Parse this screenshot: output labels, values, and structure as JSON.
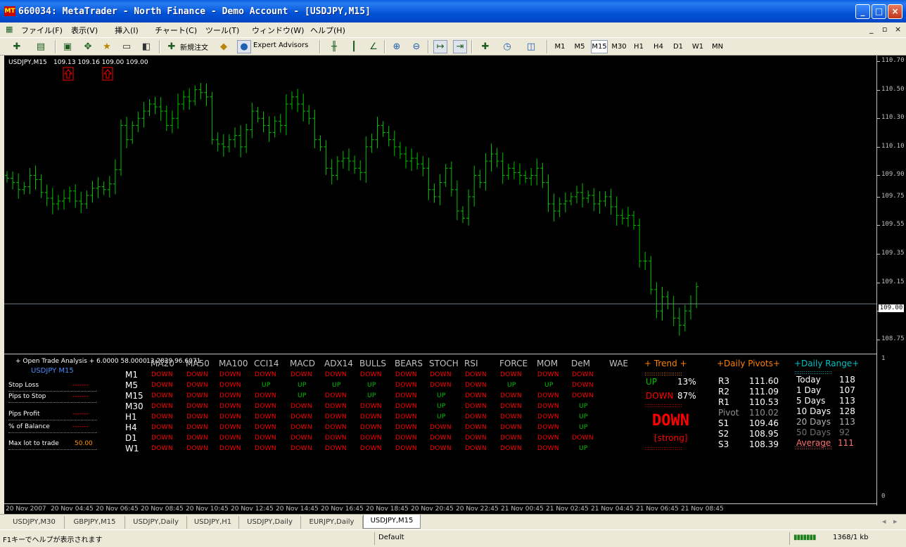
{
  "window": {
    "title": "660034: MetaTrader - North Finance - Demo Account - [USDJPY,M15]",
    "app_icon": "MT",
    "buttons": {
      "minimize": "_",
      "maximize": "□",
      "close": "×"
    }
  },
  "menu": {
    "items": [
      "ファイル(F)",
      "表示(V)",
      "挿入(I)",
      "チャート(C)",
      "ツール(T)",
      "ウィンドウ(W)",
      "ヘルプ(H)"
    ],
    "mdi_buttons": [
      "_",
      "▫",
      "×"
    ]
  },
  "toolbar": {
    "new_order_label": "新規注文",
    "expert_advisors_label": "Expert Advisors",
    "timeframes": [
      "M1",
      "M5",
      "M15",
      "M30",
      "H1",
      "H4",
      "D1",
      "W1",
      "MN"
    ],
    "active_timeframe": "M15"
  },
  "chart": {
    "symbol_header": "USDJPY,M15",
    "ohlc": "109.13 109.16 109.00 109.00",
    "price_axis": [
      "110.70",
      "110.50",
      "110.30",
      "110.10",
      "109.90",
      "109.75",
      "109.55",
      "109.35",
      "109.15",
      "108.95",
      "108.75"
    ],
    "current_price": "109.00",
    "time_axis": [
      "20 Nov 2007",
      "20 Nov 04:45",
      "20 Nov 06:45",
      "20 Nov 08:45",
      "20 Nov 10:45",
      "20 Nov 12:45",
      "20 Nov 14:45",
      "20 Nov 16:45",
      "20 Nov 18:45",
      "20 Nov 20:45",
      "20 Nov 22:45",
      "21 Nov 00:45",
      "21 Nov 02:45",
      "21 Nov 04:45",
      "21 Nov 06:45",
      "21 Nov 08:45"
    ],
    "bar_color": "#00c000",
    "arrow_color": "#ff0000",
    "indicator_scale": [
      "1",
      "0"
    ]
  },
  "chart_data": {
    "type": "line",
    "title": "USDJPY,M15",
    "ylim": [
      108.7,
      110.72
    ],
    "series": [
      {
        "values": [
          109.88,
          109.85,
          109.8,
          109.82,
          109.9,
          109.87,
          109.78,
          109.74,
          109.7,
          109.72,
          109.74,
          109.79,
          109.72,
          109.7,
          109.76,
          109.81,
          109.82,
          109.8,
          109.84,
          109.94,
          110.25,
          110.15,
          110.25,
          110.3,
          110.35,
          110.4,
          110.38,
          110.35,
          110.25,
          110.3,
          110.4,
          110.45,
          110.42,
          110.5,
          110.48,
          110.45,
          110.15,
          110.12,
          110.1,
          110.15,
          110.18,
          110.1,
          110.22,
          110.35,
          110.3,
          110.25,
          110.2,
          110.28,
          110.25,
          110.4,
          110.45,
          110.4,
          110.35,
          110.3,
          110.15,
          110.1,
          109.95,
          109.9,
          110.0,
          110.02,
          110.0,
          109.95,
          109.92,
          110.1,
          110.15,
          110.25,
          110.2,
          110.15,
          110.1,
          110.05,
          110.0,
          110.02,
          109.98,
          109.95,
          109.8,
          109.75,
          109.85,
          109.95,
          109.8,
          109.65,
          109.6,
          109.75,
          109.9,
          109.85,
          110.0,
          110.05,
          110.0,
          109.9,
          109.95,
          109.92,
          109.9,
          109.88,
          109.9,
          109.95,
          109.85,
          109.7,
          109.65,
          109.7,
          109.72,
          109.75,
          109.78,
          109.74,
          109.76,
          109.7,
          109.72,
          109.75,
          109.68,
          109.62,
          109.6,
          109.62,
          109.55,
          109.3,
          109.3,
          109.1,
          108.95,
          109.05,
          109.0,
          108.9,
          108.85,
          108.95,
          109.0,
          109.12
        ]
      }
    ]
  },
  "overlay": {
    "open_trade": "+ Open Trade Analysis + 6.0000 58.0000",
    "open_trade_values": "13.2829 96.6071",
    "symbol": "USDJPY  M15",
    "labels": [
      "Stop Loss",
      "Pips to Stop",
      "Pips Profit",
      "% of Balance",
      "Max lot to trade"
    ],
    "values": [
      "-------",
      "-------",
      "-------",
      "-------",
      "50.00"
    ],
    "indicator_headers": [
      "MA20",
      "MA50",
      "MA100",
      "CCI14",
      "MACD",
      "ADX14",
      "BULLS",
      "BEARS",
      "STOCH",
      "RSI",
      "FORCE",
      "MOM",
      "DeM",
      "WAE"
    ],
    "timeframes": [
      "M1",
      "M5",
      "M15",
      "M30",
      "H1",
      "H4",
      "D1",
      "W1"
    ],
    "matrix": [
      [
        "DOWN",
        "DOWN",
        "DOWN",
        "DOWN",
        "DOWN",
        "DOWN",
        "DOWN",
        "DOWN",
        "DOWN",
        "DOWN",
        "DOWN",
        "DOWN",
        "DOWN"
      ],
      [
        "DOWN",
        "DOWN",
        "DOWN",
        "UP",
        "UP",
        "UP",
        "UP",
        "DOWN",
        "DOWN",
        "DOWN",
        "UP",
        "UP",
        "DOWN"
      ],
      [
        "DOWN",
        "DOWN",
        "DOWN",
        "DOWN",
        "UP",
        "DOWN",
        "UP",
        "DOWN",
        "UP",
        "DOWN",
        "DOWN",
        "DOWN",
        "DOWN"
      ],
      [
        "DOWN",
        "DOWN",
        "DOWN",
        "DOWN",
        "DOWN",
        "DOWN",
        "DOWN",
        "DOWN",
        "UP",
        "DOWN",
        "DOWN",
        "DOWN",
        "UP"
      ],
      [
        "DOWN",
        "DOWN",
        "DOWN",
        "DOWN",
        "DOWN",
        "DOWN",
        "DOWN",
        "DOWN",
        "UP",
        "DOWN",
        "DOWN",
        "DOWN",
        "UP"
      ],
      [
        "DOWN",
        "DOWN",
        "DOWN",
        "DOWN",
        "DOWN",
        "DOWN",
        "DOWN",
        "DOWN",
        "DOWN",
        "DOWN",
        "DOWN",
        "DOWN",
        "UP"
      ],
      [
        "DOWN",
        "DOWN",
        "DOWN",
        "DOWN",
        "DOWN",
        "DOWN",
        "DOWN",
        "DOWN",
        "DOWN",
        "DOWN",
        "DOWN",
        "DOWN",
        "DOWN"
      ],
      [
        "DOWN",
        "DOWN",
        "DOWN",
        "DOWN",
        "DOWN",
        "DOWN",
        "DOWN",
        "DOWN",
        "DOWN",
        "DOWN",
        "DOWN",
        "DOWN",
        "UP"
      ]
    ],
    "trend": {
      "header": "+ Trend +",
      "up_label": "UP",
      "up_pct": "13%",
      "down_label": "DOWN",
      "down_pct": "87%",
      "dots": "::::::::::::::::::::",
      "signal": "DOWN",
      "strength": "[strong]"
    },
    "pivots": {
      "header": "+Daily Pivots+",
      "rows": [
        {
          "label": "R3",
          "value": "111.60"
        },
        {
          "label": "R2",
          "value": "111.09"
        },
        {
          "label": "R1",
          "value": "110.53"
        },
        {
          "label": "Pivot",
          "value": "110.02"
        },
        {
          "label": "S1",
          "value": "109.46"
        },
        {
          "label": "S2",
          "value": "108.95"
        },
        {
          "label": "S3",
          "value": "108.39"
        }
      ]
    },
    "range": {
      "header": "+Daily Range+",
      "rows": [
        {
          "label": "Today",
          "value": "118"
        },
        {
          "label": "1 Day",
          "value": "107"
        },
        {
          "label": "5 Days",
          "value": "113"
        },
        {
          "label": "10 Days",
          "value": "128"
        },
        {
          "label": "20 Days",
          "value": "113"
        },
        {
          "label": "50 Days",
          "value": "92"
        }
      ],
      "average_label": "Average",
      "average_value": "111"
    },
    "colors": {
      "up": "#00c000",
      "down": "#ff0000",
      "header": "#c0c0c0",
      "white": "#ffffff",
      "orange": "#ff7f00"
    }
  },
  "tabs": [
    "USDJPY,M30",
    "GBPJPY,M15",
    "USDJPY,Daily",
    "USDJPY,H1",
    "USDJPY,Daily",
    "EURJPY,Daily",
    "USDJPY,M15"
  ],
  "active_tab": "USDJPY,M15",
  "status": {
    "help": "F1キーでヘルプが表示されます",
    "profile": "Default",
    "traffic": "1368/1 kb"
  }
}
